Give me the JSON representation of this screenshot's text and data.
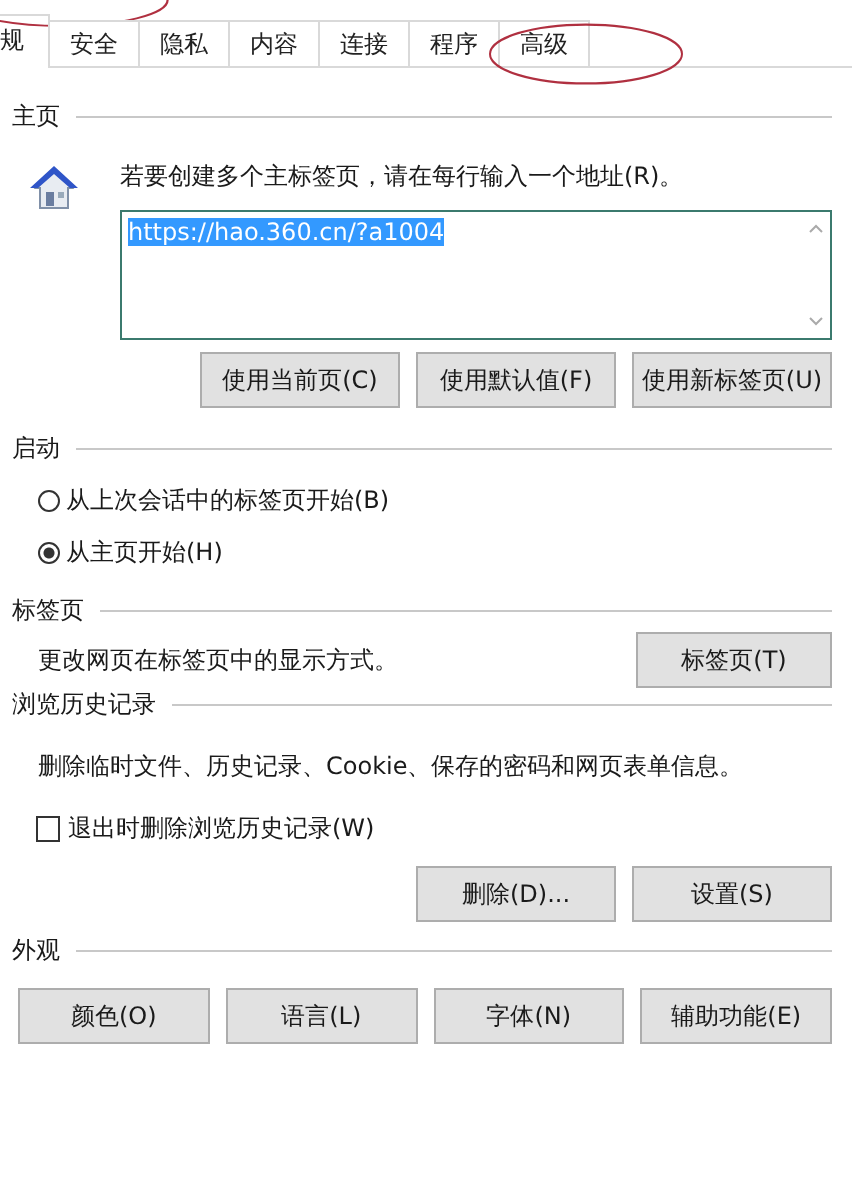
{
  "tabs": [
    {
      "label": "规",
      "selected": true,
      "circled": true
    },
    {
      "label": "安全",
      "selected": false,
      "circled": false
    },
    {
      "label": "隐私",
      "selected": false,
      "circled": false
    },
    {
      "label": "内容",
      "selected": false,
      "circled": false
    },
    {
      "label": "连接",
      "selected": false,
      "circled": false
    },
    {
      "label": "程序",
      "selected": false,
      "circled": false
    },
    {
      "label": "高级",
      "selected": false,
      "circled": true
    }
  ],
  "home": {
    "heading": "主页",
    "description": "若要创建多个主标签页，请在每行输入一个地址(R)。",
    "value": "https://hao.360.cn/?a1004",
    "buttons": [
      "使用当前页(C)",
      "使用默认值(F)",
      "使用新标签页(U)"
    ]
  },
  "startup": {
    "heading": "启动",
    "options": [
      {
        "label": "从上次会话中的标签页开始(B)",
        "selected": false
      },
      {
        "label": "从主页开始(H)",
        "selected": true
      }
    ]
  },
  "tabs_section": {
    "heading": "标签页",
    "description": "更改网页在标签页中的显示方式。",
    "button": "标签页(T)"
  },
  "history": {
    "heading": "浏览历史记录",
    "description": "删除临时文件、历史记录、Cookie、保存的密码和网页表单信息。",
    "checkbox": {
      "label": "退出时删除浏览历史记录(W)",
      "checked": false
    },
    "buttons": [
      "删除(D)...",
      "设置(S)"
    ]
  },
  "appearance": {
    "heading": "外观",
    "buttons": [
      "颜色(O)",
      "语言(L)",
      "字体(N)",
      "辅助功能(E)"
    ]
  }
}
